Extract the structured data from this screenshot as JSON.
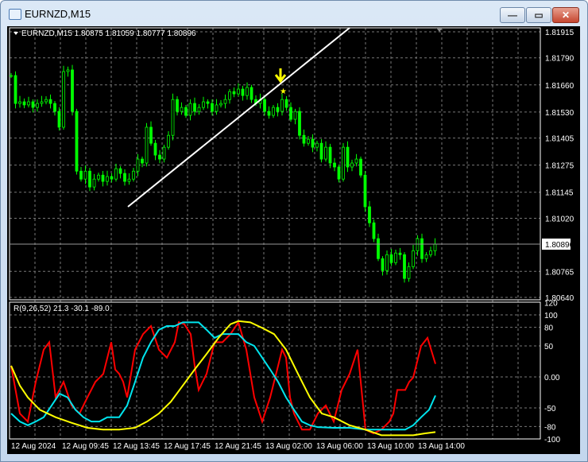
{
  "window": {
    "title": "EURNZD,M15",
    "minimize": "—",
    "maximize": "▭",
    "close": "✕"
  },
  "chart": {
    "header": "EURNZD,M15  1.80875 1.81059 1.80777 1.80896",
    "current_price": "1.80896",
    "price_labels": [
      "1.81915",
      "1.81790",
      "1.81660",
      "1.81530",
      "1.81405",
      "1.81275",
      "1.81145",
      "1.81020",
      "1.80765",
      "1.80640"
    ],
    "indicator_header": "R(9,26,52) 21.3 -30.1 -89.0",
    "indicator_labels": [
      "120",
      "100",
      "80",
      "50",
      "0.00",
      "-50",
      "-80",
      "-100"
    ],
    "time_labels": [
      "12 Aug 2024",
      "12 Aug 09:45",
      "12 Aug 13:45",
      "12 Aug 17:45",
      "12 Aug 21:45",
      "13 Aug 02:00",
      "13 Aug 06:00",
      "13 Aug 10:00",
      "13 Aug 14:00"
    ],
    "colors": {
      "bull": "#00ff00",
      "fast": "#ff0000",
      "mid": "#00e5ee",
      "slow": "#ffff00"
    }
  },
  "chart_data": {
    "type": "line",
    "title": "EURNZD,M15",
    "price_range": [
      1.8064,
      1.81915
    ],
    "closes": [
      1.81705,
      1.81571,
      1.81579,
      1.81564,
      1.81579,
      1.81552,
      1.81571,
      1.81579,
      1.8159,
      1.81571,
      1.81533,
      1.81457,
      1.81724,
      1.81732,
      1.81533,
      1.81246,
      1.81208,
      1.81246,
      1.8117,
      1.81208,
      1.81227,
      1.81197,
      1.8122,
      1.81208,
      1.81258,
      1.81235,
      1.81197,
      1.81208,
      1.81246,
      1.81304,
      1.81285,
      1.81457,
      1.8138,
      1.81323,
      1.81304,
      1.81361,
      1.81418,
      1.8159,
      1.81533,
      1.81552,
      1.81514,
      1.81571,
      1.81533,
      1.81552,
      1.81579,
      1.81571,
      1.81533,
      1.81564,
      1.81571,
      1.8159,
      1.81628,
      1.81617,
      1.8164,
      1.81609,
      1.81648,
      1.8159,
      1.81571,
      1.8159,
      1.81533,
      1.81514,
      1.81552,
      1.81533,
      1.8159,
      1.81552,
      1.81495,
      1.81533,
      1.81418,
      1.8138,
      1.81399,
      1.81361,
      1.8138,
      1.81304,
      1.81361,
      1.81285,
      1.81266,
      1.81208,
      1.81361,
      1.81266,
      1.81285,
      1.81304,
      1.81227,
      1.81075,
      1.80998,
      1.80922,
      1.80826,
      1.80769,
      1.80845,
      1.80807,
      1.80853,
      1.80845,
      1.80731,
      1.80788,
      1.80864,
      1.80922,
      1.80826,
      1.80845,
      1.80864,
      1.80896
    ],
    "indicator": {
      "range": [
        -100,
        120
      ],
      "fast": [
        [
          14,
          18
        ],
        [
          25,
          -59
        ],
        [
          35,
          -72
        ],
        [
          45,
          -8
        ],
        [
          55,
          44
        ],
        [
          62,
          56
        ],
        [
          70,
          -33
        ],
        [
          80,
          -8
        ],
        [
          90,
          -46
        ],
        [
          100,
          -59
        ],
        [
          110,
          -33
        ],
        [
          120,
          -8
        ],
        [
          130,
          5
        ],
        [
          140,
          56
        ],
        [
          145,
          12
        ],
        [
          150,
          5
        ],
        [
          155,
          -8
        ],
        [
          160,
          -33
        ],
        [
          170,
          44
        ],
        [
          180,
          69
        ],
        [
          190,
          82
        ],
        [
          200,
          44
        ],
        [
          210,
          31
        ],
        [
          220,
          56
        ],
        [
          225,
          88
        ],
        [
          232,
          85
        ],
        [
          240,
          69
        ],
        [
          245,
          18
        ],
        [
          250,
          -21
        ],
        [
          260,
          5
        ],
        [
          270,
          56
        ],
        [
          280,
          56
        ],
        [
          290,
          69
        ],
        [
          300,
          88
        ],
        [
          310,
          44
        ],
        [
          320,
          -33
        ],
        [
          330,
          -72
        ],
        [
          340,
          -33
        ],
        [
          350,
          18
        ],
        [
          355,
          44
        ],
        [
          360,
          31
        ],
        [
          365,
          -33
        ],
        [
          370,
          -59
        ],
        [
          380,
          -85
        ],
        [
          390,
          -85
        ],
        [
          400,
          -59
        ],
        [
          410,
          -46
        ],
        [
          420,
          -72
        ],
        [
          430,
          -21
        ],
        [
          440,
          5
        ],
        [
          450,
          44
        ],
        [
          455,
          -21
        ],
        [
          460,
          -85
        ],
        [
          470,
          -91
        ],
        [
          480,
          -85
        ],
        [
          490,
          -72
        ],
        [
          495,
          -59
        ],
        [
          500,
          -21
        ],
        [
          510,
          -21
        ],
        [
          515,
          -8
        ],
        [
          520,
          -1
        ],
        [
          530,
          50
        ],
        [
          538,
          63
        ],
        [
          548,
          21
        ]
      ],
      "mid": [
        [
          14,
          -59
        ],
        [
          25,
          -72
        ],
        [
          35,
          -78
        ],
        [
          45,
          -72
        ],
        [
          55,
          -65
        ],
        [
          65,
          -46
        ],
        [
          75,
          -27
        ],
        [
          85,
          -33
        ],
        [
          95,
          -53
        ],
        [
          105,
          -65
        ],
        [
          115,
          -72
        ],
        [
          125,
          -72
        ],
        [
          135,
          -65
        ],
        [
          150,
          -65
        ],
        [
          160,
          -46
        ],
        [
          170,
          -8
        ],
        [
          180,
          31
        ],
        [
          190,
          56
        ],
        [
          200,
          76
        ],
        [
          210,
          82
        ],
        [
          220,
          82
        ],
        [
          230,
          88
        ],
        [
          240,
          88
        ],
        [
          250,
          88
        ],
        [
          260,
          76
        ],
        [
          270,
          63
        ],
        [
          280,
          69
        ],
        [
          290,
          69
        ],
        [
          300,
          69
        ],
        [
          310,
          56
        ],
        [
          320,
          50
        ],
        [
          330,
          31
        ],
        [
          340,
          12
        ],
        [
          350,
          -8
        ],
        [
          360,
          -33
        ],
        [
          370,
          -53
        ],
        [
          380,
          -72
        ],
        [
          390,
          -78
        ],
        [
          400,
          -81
        ],
        [
          420,
          -82
        ],
        [
          440,
          -82
        ],
        [
          460,
          -85
        ],
        [
          480,
          -85
        ],
        [
          500,
          -85
        ],
        [
          510,
          -85
        ],
        [
          520,
          -78
        ],
        [
          530,
          -65
        ],
        [
          540,
          -53
        ],
        [
          548,
          -30
        ]
      ],
      "slow": [
        [
          14,
          18
        ],
        [
          25,
          -14
        ],
        [
          35,
          -33
        ],
        [
          50,
          -53
        ],
        [
          70,
          -65
        ],
        [
          90,
          -74
        ],
        [
          110,
          -82
        ],
        [
          130,
          -85
        ],
        [
          150,
          -85
        ],
        [
          170,
          -82
        ],
        [
          185,
          -72
        ],
        [
          200,
          -59
        ],
        [
          215,
          -40
        ],
        [
          230,
          -14
        ],
        [
          245,
          12
        ],
        [
          260,
          37
        ],
        [
          275,
          63
        ],
        [
          290,
          85
        ],
        [
          300,
          90
        ],
        [
          315,
          88
        ],
        [
          330,
          79
        ],
        [
          345,
          69
        ],
        [
          360,
          44
        ],
        [
          375,
          5
        ],
        [
          390,
          -33
        ],
        [
          405,
          -59
        ],
        [
          420,
          -65
        ],
        [
          440,
          -78
        ],
        [
          460,
          -85
        ],
        [
          480,
          -94
        ],
        [
          500,
          -94
        ],
        [
          520,
          -94
        ],
        [
          535,
          -91
        ],
        [
          548,
          -89
        ]
      ]
    }
  }
}
